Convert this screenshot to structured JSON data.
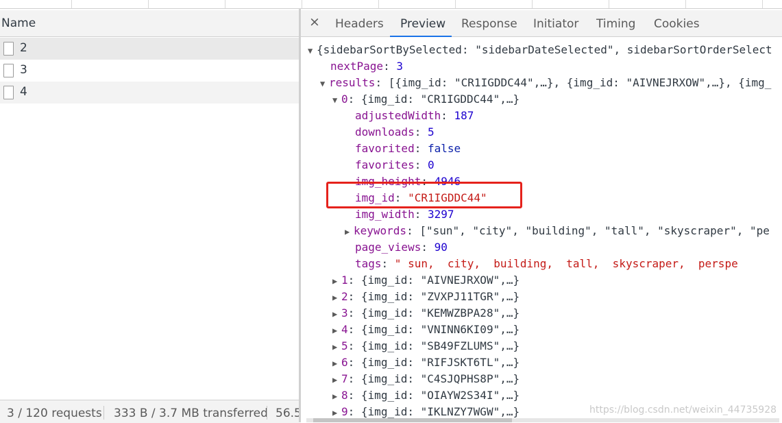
{
  "network_list": {
    "header": "Name",
    "requests": [
      "2",
      "3",
      "4"
    ],
    "status": {
      "requests": "3 / 120 requests",
      "transferred": "333 B / 3.7 MB transferred",
      "resources": "56.5"
    }
  },
  "detail_tabs": {
    "close": "×",
    "tabs": [
      "Headers",
      "Preview",
      "Response",
      "Initiator",
      "Timing",
      "Cookies"
    ],
    "active": "Preview"
  },
  "preview": {
    "root_brace": "{",
    "root_k1": "sidebarSortBySelected",
    "root_v1": "\"sidebarDateSelected\"",
    "root_k2": "sidebarSortOrderSelect",
    "nextPage_key": "nextPage",
    "nextPage_val": "3",
    "results_key": "results",
    "results_preview": "[{img_id: \"CR1IGDDC44\",…}, {img_id: \"AIVNEJRXOW\",…}, {img_",
    "item0_key": "0",
    "item0_preview": "{img_id: \"CR1IGDDC44\",…}",
    "fields": [
      {
        "key": "adjustedWidth",
        "val": "187",
        "type": "n"
      },
      {
        "key": "downloads",
        "val": "5",
        "type": "n"
      },
      {
        "key": "favorited",
        "val": "false",
        "type": "b"
      },
      {
        "key": "favorites",
        "val": "0",
        "type": "n"
      },
      {
        "key": "img_height",
        "val": "4946",
        "type": "n"
      },
      {
        "key": "img_id",
        "val": "\"CR1IGDDC44\"",
        "type": "s"
      },
      {
        "key": "img_width",
        "val": "3297",
        "type": "n"
      }
    ],
    "keywords_key": "keywords",
    "keywords_val": "[\"sun\", \"city\", \"building\", \"tall\", \"skyscraper\", \"pe",
    "page_views_key": "page_views",
    "page_views_val": "90",
    "tags_key": "tags",
    "tags_val": "\" sun,  city,  building,  tall,  skyscraper,  perspe",
    "items": [
      {
        "key": "1",
        "id": "\"AIVNEJRXOW\""
      },
      {
        "key": "2",
        "id": "\"ZVXPJ11TGR\""
      },
      {
        "key": "3",
        "id": "\"KEMWZBPA28\""
      },
      {
        "key": "4",
        "id": "\"VNINN6KI09\""
      },
      {
        "key": "5",
        "id": "\"SB49FZLUMS\""
      },
      {
        "key": "6",
        "id": "\"RIFJSKT6TL\""
      },
      {
        "key": "7",
        "id": "\"C4SJQPHS8P\""
      },
      {
        "key": "8",
        "id": "\"OIAYW2S34I\""
      },
      {
        "key": "9",
        "id": "\"IKLNZY7WGW\""
      }
    ]
  },
  "watermark": "https://blog.csdn.net/weixin_44735928",
  "colors": {
    "highlight": "#e5221c",
    "accent": "#1a73e8",
    "key": "#881391",
    "string": "#c41a16",
    "number": "#1c00cf"
  }
}
